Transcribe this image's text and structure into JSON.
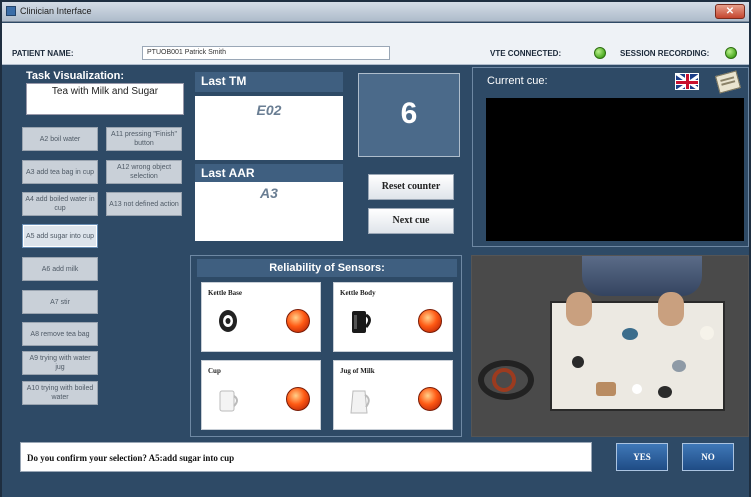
{
  "window": {
    "title": "Clinician Interface",
    "close_label": "✕"
  },
  "patient": {
    "name_label": "PATIENT NAME:",
    "name_value": "PTUOB001 Patrick Smith",
    "vte_label": "VTE CONNECTED:",
    "session_label": "SESSION RECORDING:"
  },
  "task": {
    "heading": "Task Visualization:",
    "name": "Tea with Milk and Sugar",
    "actions_left": [
      "A2 boil water",
      "A3 add tea bag in cup",
      "A4 add boiled water in cup",
      "A5 add sugar into cup",
      "A6 add milk",
      "A7 stir",
      "A8 remove tea bag",
      "A9 trying with water jug",
      "A10 trying with boiled water"
    ],
    "actions_right": [
      "A11 pressing \"Finish\" button",
      "A12 wrong object selection",
      "A13 not defined action"
    ]
  },
  "last_tm": {
    "label": "Last TM",
    "value": "E02"
  },
  "last_aar": {
    "label": "Last AAR",
    "value": "A3"
  },
  "counter": {
    "value": "6"
  },
  "controls": {
    "reset_label": "Reset counter",
    "next_label": "Next cue"
  },
  "cue": {
    "label": "Current cue:"
  },
  "sensors": {
    "heading": "Reliability of Sensors:",
    "items": [
      {
        "name": "Kettle Base",
        "status_color": "#ff5a14"
      },
      {
        "name": "Kettle Body",
        "status_color": "#ff5a14"
      },
      {
        "name": "Cup",
        "status_color": "#ff5a14"
      },
      {
        "name": "Jug of Milk",
        "status_color": "#ff5a14"
      }
    ]
  },
  "confirm": {
    "question": "Do you confirm your selection? A5:add sugar into cup",
    "yes_label": "YES",
    "no_label": "NO"
  },
  "colors": {
    "panel_bg": "#2e4a66",
    "header_bg": "#3f5f80",
    "status_ok": "#4caa22",
    "button_blue": "#1f4c85"
  }
}
